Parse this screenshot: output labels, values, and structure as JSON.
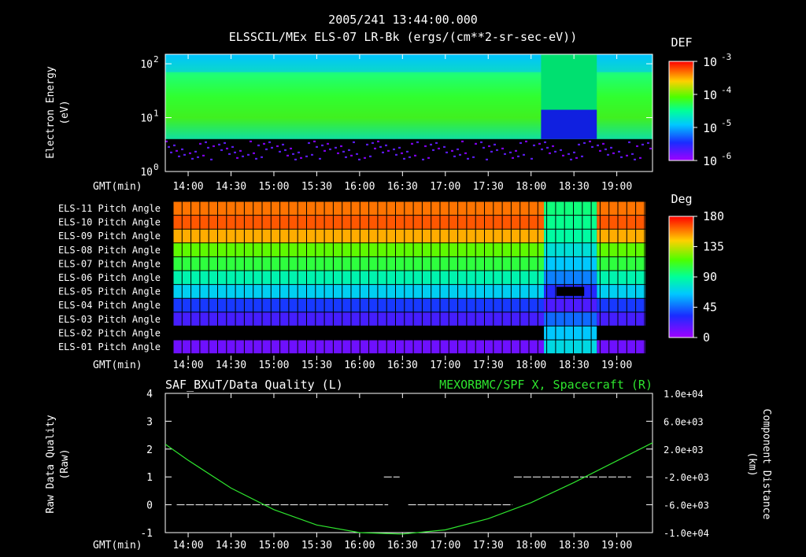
{
  "header": {
    "title": "2005/241 13:44:00.000",
    "subtitle": "ELSSCIL/MEx ELS-07 LR-Bk  (ergs/(cm**2-sr-sec-eV))"
  },
  "time_axis": {
    "label": "GMT(min)",
    "ticks": [
      "14:00",
      "14:30",
      "15:00",
      "15:30",
      "16:00",
      "16:30",
      "17:00",
      "17:30",
      "18:00",
      "18:30",
      "19:00"
    ]
  },
  "chart_data": [
    {
      "type": "heatmap",
      "title": "ELSSCIL/MEx ELS-07 LR-Bk  (ergs/(cm**2-sr-sec-eV))",
      "ylabel": [
        "Electron Energy",
        "(eV)"
      ],
      "yscale": "log",
      "ylim": [
        1,
        150
      ],
      "ytick_labels": [
        {
          "base": "10",
          "exp": "2"
        },
        {
          "base": "10",
          "exp": "1"
        },
        {
          "base": "10",
          "exp": "0"
        }
      ],
      "xlim": [
        "13:44",
        "19:25"
      ],
      "colorbar": {
        "label": "DEF",
        "scale": "log",
        "tick_labels": [
          {
            "base": "10",
            "exp": "-3"
          },
          {
            "base": "10",
            "exp": "-4"
          },
          {
            "base": "10",
            "exp": "-5"
          },
          {
            "base": "10",
            "exp": "-6"
          }
        ]
      },
      "features": {
        "low_energy_cutoff_eV": 4,
        "depleted_interval": [
          "18:07",
          "18:46"
        ]
      }
    },
    {
      "type": "heatmap",
      "colorbar": {
        "label": "Deg",
        "tick_labels": [
          "180",
          "135",
          "90",
          "45",
          "0"
        ],
        "range": [
          0,
          180
        ]
      },
      "rows": [
        {
          "label": "ELS-11 Pitch Angle",
          "angle": 160
        },
        {
          "label": "ELS-10 Pitch Angle",
          "angle": 165
        },
        {
          "label": "ELS-09 Pitch Angle",
          "angle": 150
        },
        {
          "label": "ELS-08 Pitch Angle",
          "angle": 118
        },
        {
          "label": "ELS-07 Pitch Angle",
          "angle": 105
        },
        {
          "label": "ELS-06 Pitch Angle",
          "angle": 85
        },
        {
          "label": "ELS-05 Pitch Angle",
          "angle": 68
        },
        {
          "label": "ELS-04 Pitch Angle",
          "angle": 35
        },
        {
          "label": "ELS-03 Pitch Angle",
          "angle": 22
        },
        {
          "label": "ELS-02 Pitch Angle",
          "angle": null
        },
        {
          "label": "ELS-01 Pitch Angle",
          "angle": 12
        }
      ],
      "transition_interval": [
        "18:09",
        "18:46"
      ],
      "transition_angles": [
        95,
        92,
        88,
        75,
        65,
        50,
        30,
        20,
        45,
        65,
        72
      ]
    },
    {
      "type": "line",
      "title_left": "SAF_BXuT/Data Quality (L)",
      "title_right": "MEXORBMC/SPF X, Spacecraft (R)",
      "ylabel_left": [
        "Raw Data Quality",
        "(Raw)"
      ],
      "ylabel_right": [
        "Component Distance",
        "(km)"
      ],
      "ylim_left": [
        -1,
        4
      ],
      "ytick_labels_left": [
        "4",
        "3",
        "2",
        "1",
        "0",
        "-1"
      ],
      "ylim_right": [
        -10000,
        10000
      ],
      "ytick_labels_right": [
        "1.0e+04",
        "6.0e+03",
        "2.0e+03",
        "-2.0e+03",
        "-6.0e+03",
        "-1.0e+04"
      ],
      "series": [
        {
          "name": "SAF_BXuT/Data Quality",
          "axis": "left",
          "color": "#ffffff",
          "segments": [
            {
              "x": [
                "13:52",
                "16:20"
              ],
              "y": 0
            },
            {
              "x": [
                "16:17",
                "16:28"
              ],
              "y": 1
            },
            {
              "x": [
                "16:34",
                "17:47"
              ],
              "y": 0
            },
            {
              "x": [
                "17:48",
                "19:10"
              ],
              "y": 1
            }
          ]
        },
        {
          "name": "MEXORBMC/SPF X, Spacecraft",
          "axis": "right",
          "color": "#2ee52e",
          "x": [
            "13:44",
            "14:00",
            "14:30",
            "15:00",
            "15:30",
            "16:00",
            "16:30",
            "17:00",
            "17:30",
            "18:00",
            "18:30",
            "19:00",
            "19:25"
          ],
          "y": [
            2700,
            400,
            -3600,
            -6700,
            -8900,
            -10000,
            -10200,
            -9600,
            -8000,
            -5700,
            -2800,
            300,
            2900
          ]
        }
      ]
    }
  ]
}
